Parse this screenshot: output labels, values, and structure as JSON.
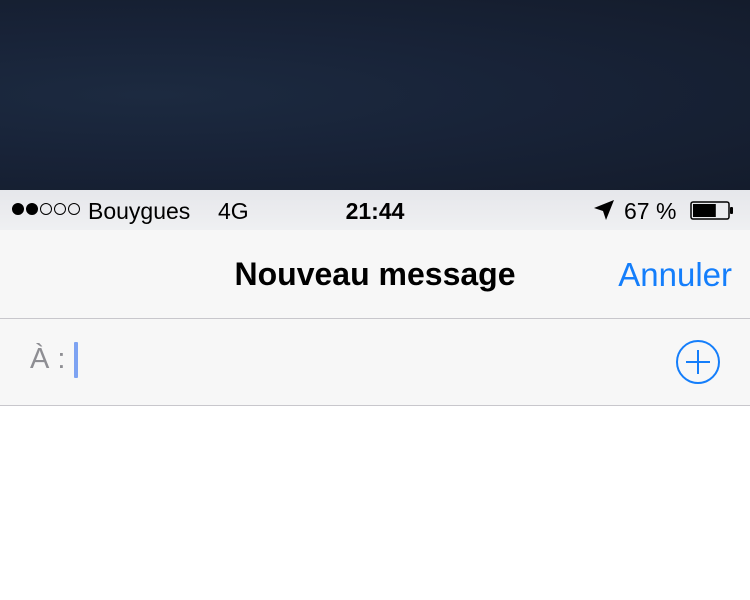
{
  "status_bar": {
    "signal_strength": 2,
    "signal_max": 5,
    "carrier": "Bouygues",
    "network": "4G",
    "time": "21:44",
    "battery_percent": "67 %",
    "battery_level": 0.67,
    "icons": [
      "location-arrow-icon",
      "battery-icon"
    ]
  },
  "nav": {
    "title": "Nouveau message",
    "cancel_label": "Annuler"
  },
  "recipient": {
    "label": "À :",
    "value": "",
    "add_icon": "plus-circle-icon"
  },
  "colors": {
    "accent": "#147efb",
    "backdrop": "#182338",
    "bar_background": "#f7f7f7",
    "separator": "#c8c7cc",
    "caret": "#7ea3f2"
  }
}
